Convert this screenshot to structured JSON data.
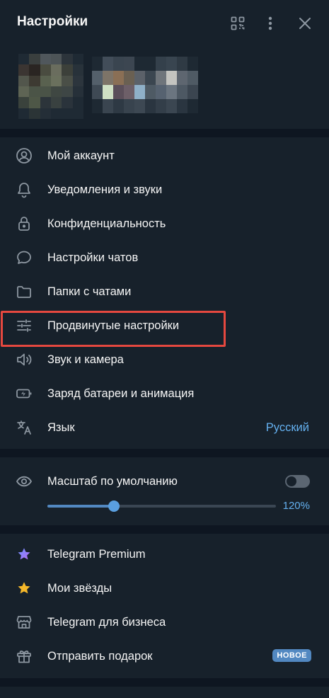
{
  "header": {
    "title": "Настройки"
  },
  "icons": {
    "qr": "qr-code-icon",
    "more": "more-vertical-icon",
    "close": "close-icon"
  },
  "menu1": [
    {
      "label": "Мой аккаунт",
      "icon": "user-circle-icon"
    },
    {
      "label": "Уведомления и звуки",
      "icon": "bell-icon"
    },
    {
      "label": "Конфиденциальность",
      "icon": "lock-icon"
    },
    {
      "label": "Настройки чатов",
      "icon": "chat-bubble-icon"
    },
    {
      "label": "Папки с чатами",
      "icon": "folder-icon"
    },
    {
      "label": "Продвинутые настройки",
      "icon": "sliders-icon"
    },
    {
      "label": "Звук и камера",
      "icon": "speaker-icon"
    },
    {
      "label": "Заряд батареи и анимация",
      "icon": "battery-icon"
    },
    {
      "label": "Язык",
      "icon": "translate-icon",
      "value": "Русский"
    }
  ],
  "scale": {
    "label": "Масштаб по умолчанию",
    "icon": "eye-icon",
    "toggle_on": false,
    "value_label": "120%",
    "slider_fraction": 0.29
  },
  "menu2": [
    {
      "label": "Telegram Premium",
      "icon": "premium-star-icon"
    },
    {
      "label": "Мои звёзды",
      "icon": "gold-star-icon"
    },
    {
      "label": "Telegram для бизнеса",
      "icon": "shop-icon"
    },
    {
      "label": "Отправить подарок",
      "icon": "gift-icon",
      "badge": "НОВОЕ"
    }
  ],
  "colors": {
    "background": "#17212b",
    "separator": "#0e1621",
    "accent": "#64b0ef",
    "highlight_box": "#e5483f"
  }
}
